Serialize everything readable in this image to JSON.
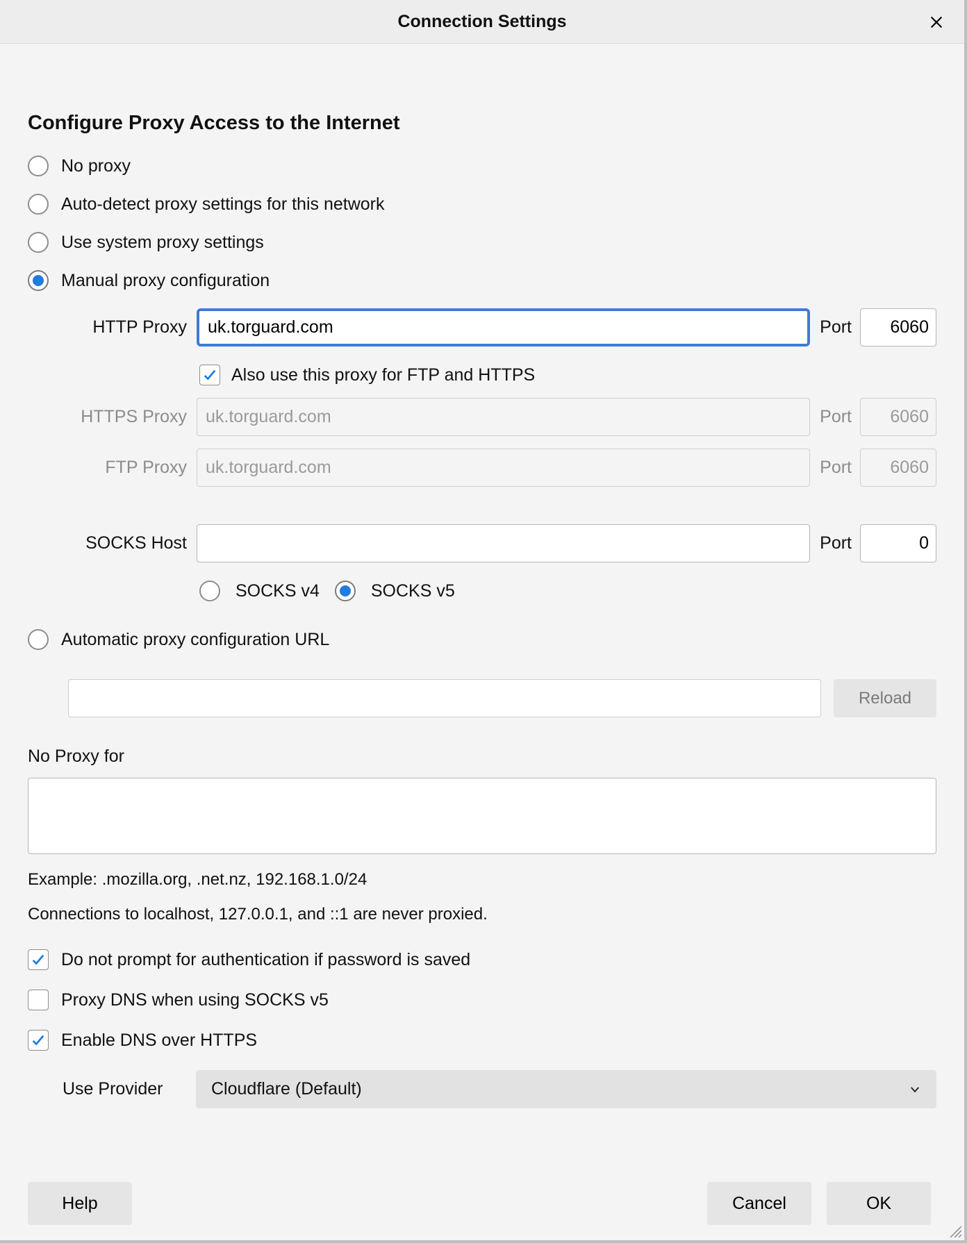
{
  "title": "Connection Settings",
  "section_heading": "Configure Proxy Access to the Internet",
  "proxy_mode": {
    "no_proxy": "No proxy",
    "auto_detect": "Auto-detect proxy settings for this network",
    "system": "Use system proxy settings",
    "manual": "Manual proxy configuration",
    "auto_url": "Automatic proxy configuration URL",
    "selected": "manual"
  },
  "manual": {
    "http_label": "HTTP Proxy",
    "http_host": "uk.torguard.com",
    "http_port": "6060",
    "share_checkbox_label": "Also use this proxy for FTP and HTTPS",
    "share_checked": true,
    "https_label": "HTTPS Proxy",
    "https_host": "uk.torguard.com",
    "https_port": "6060",
    "ftp_label": "FTP Proxy",
    "ftp_host": "uk.torguard.com",
    "ftp_port": "6060",
    "socks_label": "SOCKS Host",
    "socks_host": "",
    "socks_port": "0",
    "port_label": "Port",
    "socks_v4_label": "SOCKS v4",
    "socks_v5_label": "SOCKS v5",
    "socks_version_selected": "v5"
  },
  "auto_config": {
    "url": "",
    "reload_label": "Reload"
  },
  "no_proxy_for": {
    "label": "No Proxy for",
    "value": "",
    "example": "Example: .mozilla.org, .net.nz, 192.168.1.0/24",
    "note": "Connections to localhost, 127.0.0.1, and ::1 are never proxied."
  },
  "options": {
    "no_auth_prompt_label": "Do not prompt for authentication if password is saved",
    "no_auth_prompt_checked": true,
    "proxy_dns_socks5_label": "Proxy DNS when using SOCKS v5",
    "proxy_dns_socks5_checked": false,
    "doh_label": "Enable DNS over HTTPS",
    "doh_checked": true,
    "provider_label": "Use Provider",
    "provider_value": "Cloudflare (Default)"
  },
  "buttons": {
    "help": "Help",
    "cancel": "Cancel",
    "ok": "OK"
  }
}
